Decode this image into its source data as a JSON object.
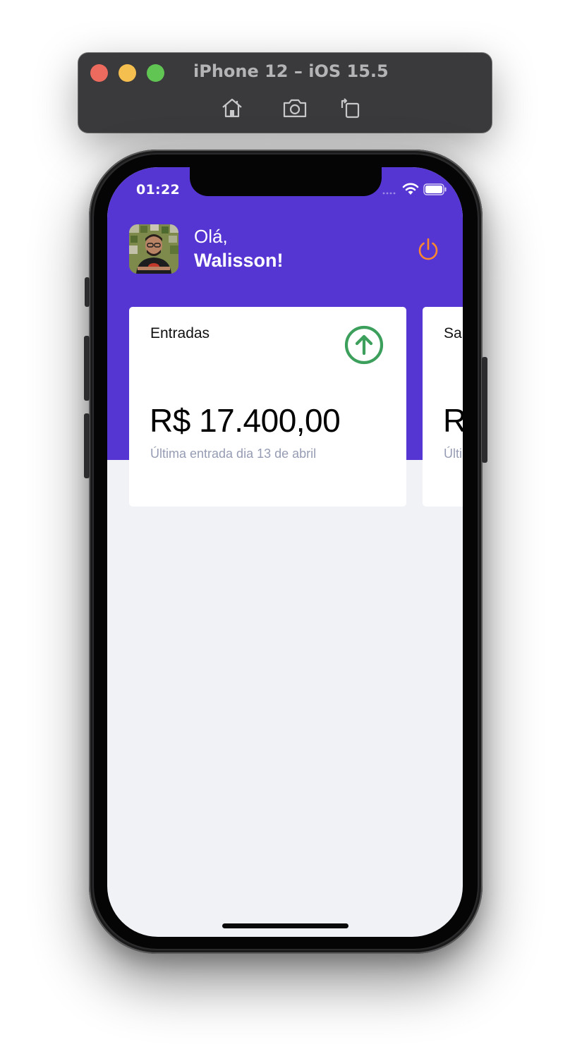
{
  "simulator": {
    "title": "iPhone 12 – iOS 15.5",
    "tools": [
      "home-icon",
      "screenshot-icon",
      "rotate-icon"
    ]
  },
  "status_bar": {
    "time": "01:22",
    "icons": [
      "signal-icon",
      "wifi-icon",
      "battery-icon"
    ]
  },
  "header": {
    "greeting": "Olá,",
    "user_name": "Walisson!",
    "logout_icon": "power-icon",
    "background_color": "#5636D3",
    "logout_color": "#FF872C"
  },
  "cards": [
    {
      "title": "Entradas",
      "amount": "R$ 17.400,00",
      "last_transaction": "Última entrada dia 13 de abril",
      "icon": "arrow-up-circle-icon",
      "icon_color": "#3C9F5C"
    },
    {
      "title": "Saídas",
      "amount": "R",
      "last_transaction": "Últi",
      "icon": "arrow-down-circle-icon"
    }
  ],
  "colors": {
    "screen_background": "#F0F2F5",
    "card_background": "#FFFFFF",
    "muted_text": "#969CB3"
  }
}
